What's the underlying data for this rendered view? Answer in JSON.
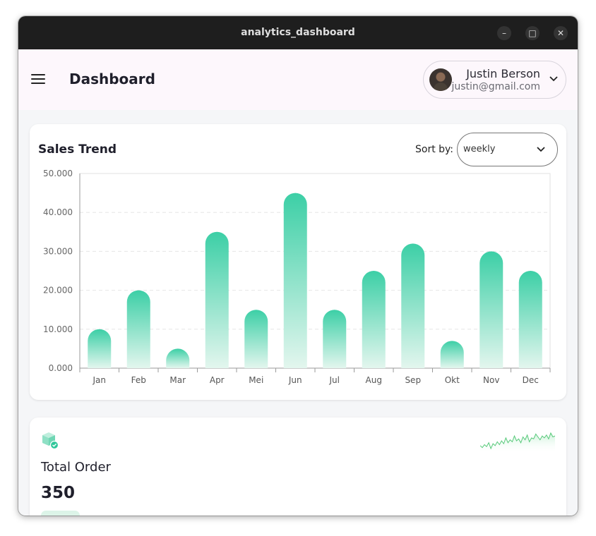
{
  "window": {
    "title": "analytics_dashboard",
    "controls": {
      "minimize": "–",
      "maximize": "□",
      "close": "✕"
    }
  },
  "appbar": {
    "title": "Dashboard",
    "menu_icon": "hamburger-menu-icon",
    "user": {
      "name": "Justin Berson",
      "email": "justin@gmail.com"
    }
  },
  "sales": {
    "title": "Sales Trend",
    "sort_label": "Sort by:",
    "sort_value": "weekly"
  },
  "chart_data": {
    "type": "bar",
    "categories": [
      "Jan",
      "Feb",
      "Mar",
      "Apr",
      "Mei",
      "Jun",
      "Jul",
      "Aug",
      "Sep",
      "Okt",
      "Nov",
      "Dec"
    ],
    "values": [
      10000,
      20000,
      5000,
      35000,
      15000,
      45000,
      15000,
      25000,
      32000,
      7000,
      30000,
      25000
    ],
    "yticks": [
      "0.000",
      "10.000",
      "20.000",
      "30.000",
      "40.000",
      "50.000"
    ],
    "ylim": [
      0,
      50000
    ],
    "grid": true,
    "colors": {
      "bar_top": "#3ccfa6",
      "bar_bottom": "#e3f6ee"
    }
  },
  "total_order": {
    "label": "Total Order",
    "value": "350",
    "icon": "box-check-icon",
    "sparkline": [
      6,
      4,
      7,
      5,
      9,
      3,
      8,
      6,
      10,
      7,
      11,
      8,
      14,
      9,
      12,
      10,
      16,
      11,
      13,
      9,
      15,
      12,
      17,
      10,
      14,
      13,
      18,
      15,
      12,
      16,
      14,
      17,
      13,
      19,
      15,
      16
    ]
  },
  "colors": {
    "accent": "#3ccfa6",
    "titlebar": "#1e1e1e",
    "appbar": "#fdf7fc"
  }
}
